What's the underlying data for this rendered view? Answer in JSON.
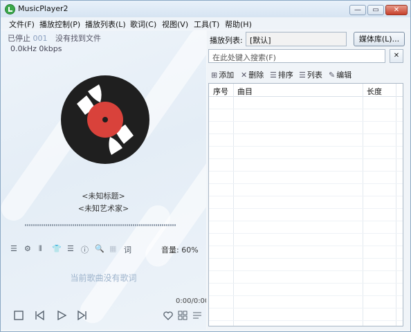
{
  "window": {
    "title": "MusicPlayer2",
    "close_glyph": "✕",
    "min_glyph": "—",
    "max_glyph": "▭"
  },
  "menu": [
    "文件(F)",
    "播放控制(P)",
    "播放列表(L)",
    "歌词(C)",
    "视图(V)",
    "工具(T)",
    "帮助(H)"
  ],
  "left": {
    "status": "已停止",
    "track_num": "001",
    "status_msg": "没有找到文件",
    "freq": "0.0kHz 0kbps",
    "song_title": "<未知标题>",
    "artist": "<未知艺术家>",
    "volume": "音量: 60%",
    "lyrics": "当前歌曲没有歌词",
    "time": "0:00/0:00",
    "toolbar_icons": [
      "list-icon",
      "settings-icon",
      "equalizer-icon",
      "shirt-icon",
      "menu-icon",
      "info-icon",
      "search-icon",
      "book-icon",
      "lyrics-icon"
    ],
    "toolbar_glyphs": [
      "☰",
      "⚙",
      "⫴",
      "👕",
      "☰",
      "ⓘ",
      "🔍",
      "▦",
      "词"
    ]
  },
  "right": {
    "playlist_label": "播放列表:",
    "playlist_name": "[默认]",
    "media_lib": "媒体库(L)...",
    "search_placeholder": "在此处键入搜索(F)",
    "search_clear": "✕",
    "toolbar": [
      {
        "icon": "⊞",
        "label": "添加"
      },
      {
        "icon": "✕",
        "label": "删除"
      },
      {
        "icon": "☰",
        "label": "排序"
      },
      {
        "icon": "☰",
        "label": "列表"
      },
      {
        "icon": "✎",
        "label": "编辑"
      }
    ],
    "columns": [
      "序号",
      "曲目",
      "长度"
    ]
  },
  "colors": {
    "accent": "#3aa84a",
    "disc": "#1f1f1f",
    "disc_label": "#d9423b"
  }
}
